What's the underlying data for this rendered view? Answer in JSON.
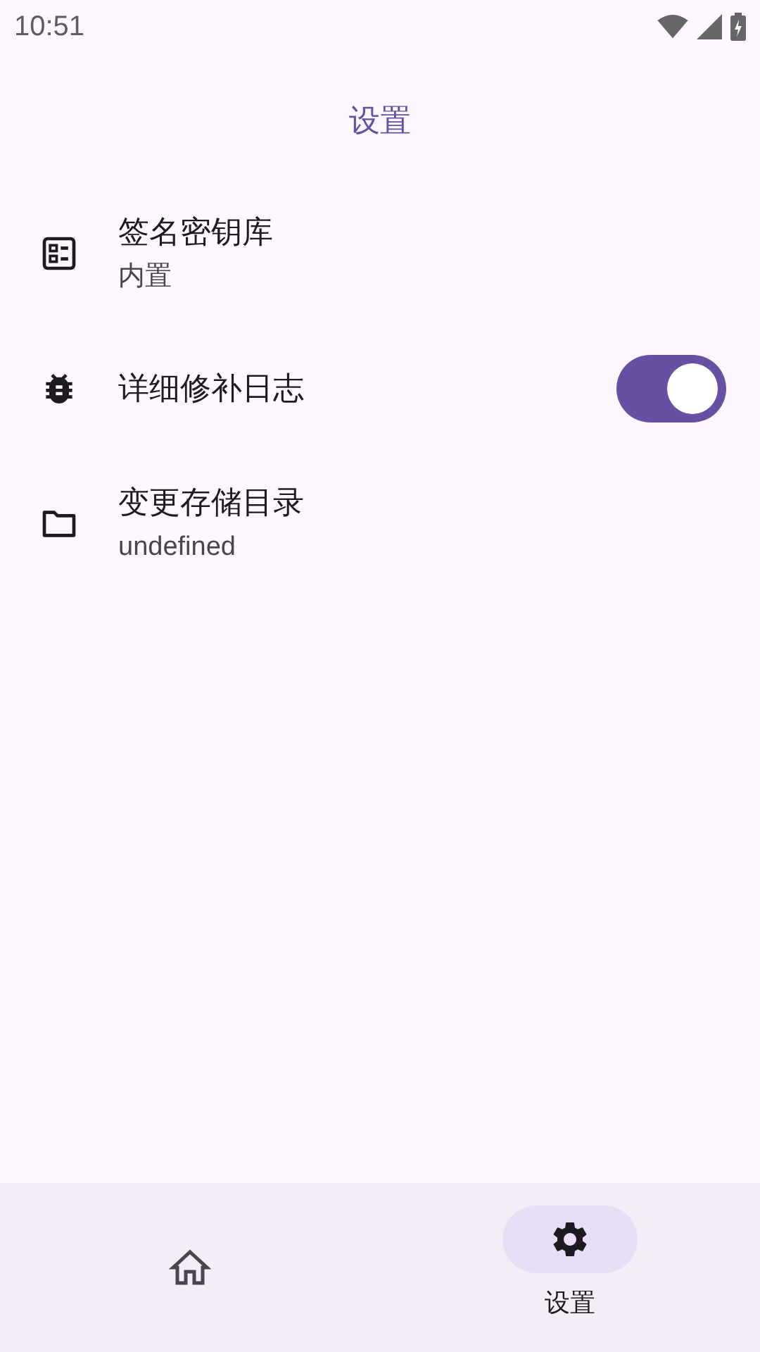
{
  "status_bar": {
    "time": "10:51"
  },
  "title": "设置",
  "settings": [
    {
      "kind": "text",
      "label": "签名密钥库",
      "value": "内置"
    },
    {
      "kind": "toggle",
      "label": "详细修补日志",
      "on": true
    },
    {
      "kind": "text",
      "label": "变更存储目录",
      "value": "undefined"
    }
  ],
  "nav": [
    {
      "selected": false
    },
    {
      "label": "设置",
      "selected": true
    }
  ]
}
